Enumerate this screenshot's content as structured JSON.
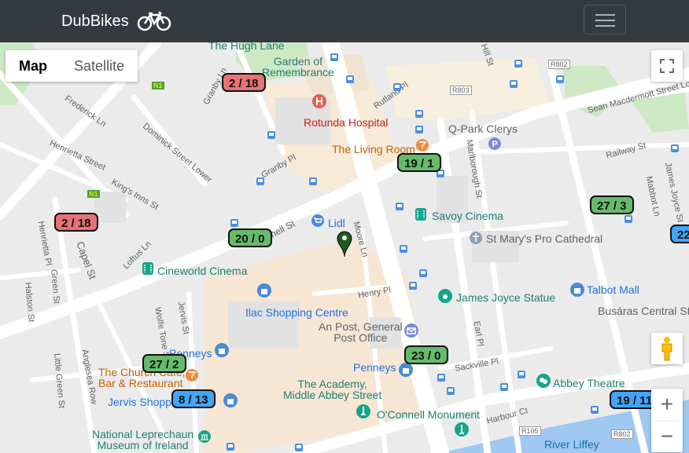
{
  "navbar": {
    "brand": "DubBikes",
    "brand_icon": "bicycle-icon",
    "toggler_icon": "hamburger-menu-icon"
  },
  "map_controls": {
    "map_type": {
      "options": [
        "Map",
        "Satellite"
      ],
      "selected": "Map"
    },
    "fullscreen_icon": "fullscreen-icon",
    "pegman_icon": "street-view-pegman-icon",
    "zoom_in": "+",
    "zoom_out": "−"
  },
  "colors": {
    "navbar": "#343a40",
    "available": "#66bb6a",
    "low": "#e57373",
    "info": "#42a5f5"
  },
  "stations": [
    {
      "label": "2 / 18",
      "status": "low"
    },
    {
      "label": "19 / 1",
      "status": "available"
    },
    {
      "label": "2 / 18",
      "status": "low"
    },
    {
      "label": "20 / 0",
      "status": "available"
    },
    {
      "label": "27 / 3",
      "status": "available"
    },
    {
      "label": "22",
      "status": "info"
    },
    {
      "label": "23 / 0",
      "status": "available"
    },
    {
      "label": "27 / 2",
      "status": "available"
    },
    {
      "label": "8 / 13",
      "status": "info"
    },
    {
      "label": "19 / 11",
      "status": "info"
    }
  ],
  "places": {
    "hugh_lane": "The Hugh Lane",
    "garden": "Garden of\nRemembrance",
    "rotunda": "Rotunda Hospital",
    "living_room": "The Living Room",
    "qpark": "Q-Park Clerys",
    "lidl": "Lidl",
    "savoy": "Savoy Cinema",
    "st_marys": "St Mary's Pro Cathedral",
    "cineworld": "Cineworld Cinema",
    "ilac": "Ilac Shopping Centre",
    "james_joyce": "James Joyce Statue",
    "talbot": "Talbot Mall",
    "busaras": "Busáras Central St",
    "an_post": "An Post, General\nPost Office",
    "penneys1": "Penneys",
    "penneys2": "Penneys",
    "church": "The Church Café,\nBar & Restaurant",
    "jervis": "Jervis Shopp",
    "academy": "The Academy,\nMiddle Abbey Street",
    "abbey": "Abbey Theatre",
    "oconnell": "O'Connell Monument",
    "leprechaun": "National Leprechaun\nMuseum of Ireland",
    "liffey": "River Liffey"
  },
  "streets": {
    "granby_ln": "Granby Ln",
    "rutland_pl": "Rutland Pl",
    "r803": "R803",
    "r802_top": "R802",
    "hill_st": "Hill St",
    "sean_mcdermott": "Sean Macdermott Street Lowe",
    "frederick_ln": "Frederick Ln",
    "henrietta_st": "Henrietta Street",
    "dominick": "Dominick Street Lower",
    "granby_pl": "Granby Pl",
    "marlborough_st": "Marlborough St",
    "railway_st": "Railway St",
    "james_joyce_st": "James Joyce St",
    "mabbot_ln": "Mabbot Ln",
    "kings_inns": "King's Inns St",
    "henrietta_pl": "Henrietta Pl",
    "capel_st": "Capel St",
    "parnell_st": "Parnell St",
    "moore_ln": "Moore Ln",
    "loftus_ln": "Loftus Ln",
    "green_st": "Green St",
    "halston": "Halston St",
    "henry_pl": "Henry Pl",
    "jervis_st": "Jervis St",
    "wolfe_tone": "Wolfe Tone St",
    "earl_pl": "Earl Pl",
    "sackville_pl": "Sackville Pl",
    "little_green": "Little Green St",
    "anglesea": "Anglesea Row",
    "harbour_ct": "Harbour Ct",
    "r105": "R105",
    "r802_bottom": "R802",
    "n1a": "N1",
    "n1b": "N1"
  }
}
